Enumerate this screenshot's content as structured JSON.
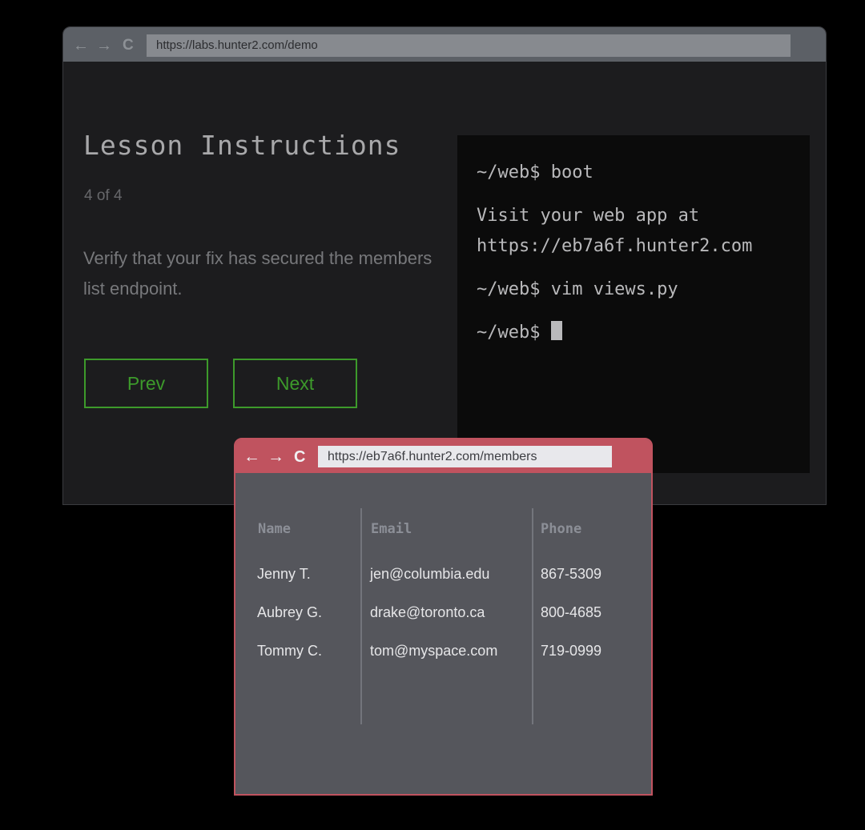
{
  "outer_browser": {
    "nav": {
      "back_icon": "←",
      "forward_icon": "→",
      "reload_icon": "C"
    },
    "url": "https://labs.hunter2.com/demo",
    "lesson": {
      "title": "Lesson Instructions",
      "step": "4 of 4",
      "description": "Verify that your fix has secured the members list endpoint.",
      "prev_label": "Prev",
      "next_label": "Next"
    },
    "terminal": {
      "lines": [
        "~/web$ boot",
        "Visit your web app at",
        "https://eb7a6f.hunter2.com",
        "~/web$ vim views.py",
        "~/web$ "
      ]
    }
  },
  "inner_browser": {
    "nav": {
      "back_icon": "←",
      "forward_icon": "→",
      "reload_icon": "C"
    },
    "url": "https://eb7a6f.hunter2.com/members",
    "table": {
      "headers": [
        "Name",
        "Email",
        "Phone"
      ],
      "rows": [
        [
          "Jenny T.",
          "jen@columbia.edu",
          "867-5309"
        ],
        [
          "Aubrey G.",
          "drake@toronto.ca",
          "800-4685"
        ],
        [
          "Tommy C.",
          "tom@myspace.com",
          "719-0999"
        ]
      ]
    }
  },
  "colors": {
    "accent_green": "#3d9a2b",
    "inner_chrome": "#c0535f",
    "outer_chrome": "#5c6066"
  }
}
